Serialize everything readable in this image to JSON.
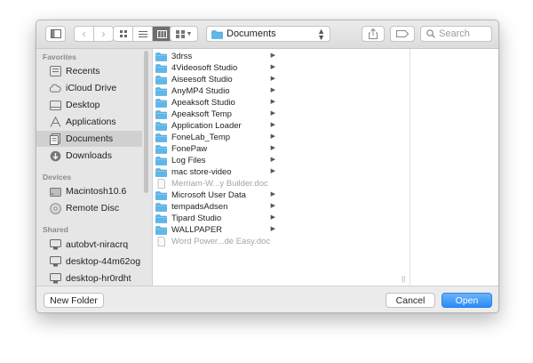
{
  "toolbar": {
    "path_folder": "Documents",
    "search_placeholder": "Search"
  },
  "sidebar": {
    "favorites_header": "Favorites",
    "favorites": [
      {
        "label": "Recents",
        "icon": "recents-icon"
      },
      {
        "label": "iCloud Drive",
        "icon": "cloud-icon"
      },
      {
        "label": "Desktop",
        "icon": "desktop-icon"
      },
      {
        "label": "Applications",
        "icon": "applications-icon"
      },
      {
        "label": "Documents",
        "icon": "documents-icon",
        "selected": true
      },
      {
        "label": "Downloads",
        "icon": "downloads-icon"
      }
    ],
    "devices_header": "Devices",
    "devices": [
      {
        "label": "Macintosh10.6",
        "icon": "hard-drive-icon"
      },
      {
        "label": "Remote Disc",
        "icon": "disc-icon"
      }
    ],
    "shared_header": "Shared",
    "shared": [
      {
        "label": "autobvt-niracrq",
        "icon": "computer-icon"
      },
      {
        "label": "desktop-44m62og",
        "icon": "computer-icon"
      },
      {
        "label": "desktop-hr0rdht",
        "icon": "computer-icon"
      }
    ]
  },
  "files": [
    {
      "name": "3drss",
      "type": "folder"
    },
    {
      "name": "4Videosoft Studio",
      "type": "folder"
    },
    {
      "name": "Aiseesoft Studio",
      "type": "folder"
    },
    {
      "name": "AnyMP4 Studio",
      "type": "folder"
    },
    {
      "name": "Apeaksoft Studio",
      "type": "folder"
    },
    {
      "name": "Apeaksoft Temp",
      "type": "folder"
    },
    {
      "name": "Application Loader",
      "type": "folder"
    },
    {
      "name": "FoneLab_Temp",
      "type": "folder"
    },
    {
      "name": "FonePaw",
      "type": "folder"
    },
    {
      "name": "Log Files",
      "type": "folder"
    },
    {
      "name": "mac store-video",
      "type": "folder"
    },
    {
      "name": "Merriam-W...y Builder.doc",
      "type": "doc"
    },
    {
      "name": "Microsoft User Data",
      "type": "folder"
    },
    {
      "name": "tempadsAdsen",
      "type": "folder"
    },
    {
      "name": "Tipard Studio",
      "type": "folder"
    },
    {
      "name": "WALLPAPER",
      "type": "folder"
    },
    {
      "name": "Word Power...de Easy.doc",
      "type": "doc"
    }
  ],
  "bottom": {
    "new_folder_label": "New Folder",
    "cancel_label": "Cancel",
    "open_label": "Open"
  },
  "colors": {
    "folder": "#5fb6ea",
    "accent": "#2a8cf7",
    "sidebar_selected": "#d0d0d0"
  }
}
